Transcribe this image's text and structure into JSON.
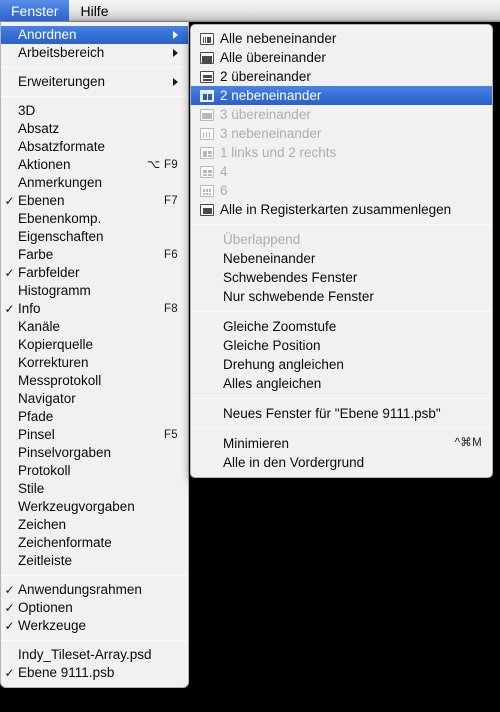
{
  "menubar": {
    "items": [
      {
        "label": "Fenster",
        "active": true
      },
      {
        "label": "Hilfe",
        "active": false
      }
    ]
  },
  "window_menu": {
    "groups": [
      {
        "items": [
          {
            "label": "Anordnen",
            "checked": false,
            "shortcut": "",
            "submenu": true,
            "selected": true,
            "disabled": false
          },
          {
            "label": "Arbeitsbereich",
            "checked": false,
            "shortcut": "",
            "submenu": true,
            "selected": false,
            "disabled": false
          }
        ]
      },
      {
        "items": [
          {
            "label": "Erweiterungen",
            "checked": false,
            "shortcut": "",
            "submenu": true,
            "selected": false,
            "disabled": false
          }
        ]
      },
      {
        "items": [
          {
            "label": "3D",
            "checked": false,
            "shortcut": ""
          },
          {
            "label": "Absatz",
            "checked": false,
            "shortcut": ""
          },
          {
            "label": "Absatzformate",
            "checked": false,
            "shortcut": ""
          },
          {
            "label": "Aktionen",
            "checked": false,
            "shortcut": "⌥ F9"
          },
          {
            "label": "Anmerkungen",
            "checked": false,
            "shortcut": ""
          },
          {
            "label": "Ebenen",
            "checked": true,
            "shortcut": "F7"
          },
          {
            "label": "Ebenenkomp.",
            "checked": false,
            "shortcut": ""
          },
          {
            "label": "Eigenschaften",
            "checked": false,
            "shortcut": ""
          },
          {
            "label": "Farbe",
            "checked": false,
            "shortcut": "F6"
          },
          {
            "label": "Farbfelder",
            "checked": true,
            "shortcut": ""
          },
          {
            "label": "Histogramm",
            "checked": false,
            "shortcut": ""
          },
          {
            "label": "Info",
            "checked": true,
            "shortcut": "F8"
          },
          {
            "label": "Kanäle",
            "checked": false,
            "shortcut": ""
          },
          {
            "label": "Kopierquelle",
            "checked": false,
            "shortcut": ""
          },
          {
            "label": "Korrekturen",
            "checked": false,
            "shortcut": ""
          },
          {
            "label": "Messprotokoll",
            "checked": false,
            "shortcut": ""
          },
          {
            "label": "Navigator",
            "checked": false,
            "shortcut": ""
          },
          {
            "label": "Pfade",
            "checked": false,
            "shortcut": ""
          },
          {
            "label": "Pinsel",
            "checked": false,
            "shortcut": "F5"
          },
          {
            "label": "Pinselvorgaben",
            "checked": false,
            "shortcut": ""
          },
          {
            "label": "Protokoll",
            "checked": false,
            "shortcut": ""
          },
          {
            "label": "Stile",
            "checked": false,
            "shortcut": ""
          },
          {
            "label": "Werkzeugvorgaben",
            "checked": false,
            "shortcut": ""
          },
          {
            "label": "Zeichen",
            "checked": false,
            "shortcut": ""
          },
          {
            "label": "Zeichenformate",
            "checked": false,
            "shortcut": ""
          },
          {
            "label": "Zeitleiste",
            "checked": false,
            "shortcut": ""
          }
        ]
      },
      {
        "items": [
          {
            "label": "Anwendungsrahmen",
            "checked": true,
            "shortcut": ""
          },
          {
            "label": "Optionen",
            "checked": true,
            "shortcut": ""
          },
          {
            "label": "Werkzeuge",
            "checked": true,
            "shortcut": ""
          }
        ]
      },
      {
        "items": [
          {
            "label": "Indy_Tileset-Array.psd",
            "checked": false,
            "shortcut": ""
          },
          {
            "label": "Ebene 9111.psb",
            "checked": true,
            "shortcut": ""
          }
        ]
      }
    ]
  },
  "arrange_submenu": {
    "groups": [
      {
        "items": [
          {
            "label": "Alle nebeneinander",
            "icon": "tile-all-vertical-icon",
            "disabled": false,
            "selected": false
          },
          {
            "label": "Alle übereinander",
            "icon": "tile-all-horizontal-icon",
            "disabled": false,
            "selected": false
          },
          {
            "label": "2 übereinander",
            "icon": "two-up-horizontal-icon",
            "disabled": false,
            "selected": false
          },
          {
            "label": "2 nebeneinander",
            "icon": "two-up-vertical-icon",
            "disabled": false,
            "selected": true
          },
          {
            "label": "3 übereinander",
            "icon": "three-up-horizontal-icon",
            "disabled": true,
            "selected": false
          },
          {
            "label": "3 nebeneinander",
            "icon": "three-up-vertical-icon",
            "disabled": true,
            "selected": false
          },
          {
            "label": "1 links und 2 rechts",
            "icon": "one-left-two-right-icon",
            "disabled": true,
            "selected": false
          },
          {
            "label": "4",
            "icon": "four-up-grid-icon",
            "disabled": true,
            "selected": false
          },
          {
            "label": "6",
            "icon": "six-up-grid-icon",
            "disabled": true,
            "selected": false
          },
          {
            "label": "Alle in Registerkarten zusammenlegen",
            "icon": "consolidate-all-tabs-icon",
            "disabled": false,
            "selected": false
          }
        ]
      },
      {
        "items": [
          {
            "label": "Überlappend",
            "icon": "",
            "disabled": true,
            "selected": false
          },
          {
            "label": "Nebeneinander",
            "icon": "",
            "disabled": false,
            "selected": false
          },
          {
            "label": "Schwebendes Fenster",
            "icon": "",
            "disabled": false,
            "selected": false
          },
          {
            "label": "Nur schwebende Fenster",
            "icon": "",
            "disabled": false,
            "selected": false
          }
        ]
      },
      {
        "items": [
          {
            "label": "Gleiche Zoomstufe",
            "icon": "",
            "disabled": false,
            "selected": false
          },
          {
            "label": "Gleiche Position",
            "icon": "",
            "disabled": false,
            "selected": false
          },
          {
            "label": "Drehung angleichen",
            "icon": "",
            "disabled": false,
            "selected": false
          },
          {
            "label": "Alles angleichen",
            "icon": "",
            "disabled": false,
            "selected": false
          }
        ]
      },
      {
        "items": [
          {
            "label": "Neues Fenster für \"Ebene 9111.psb\"",
            "icon": "",
            "disabled": false,
            "selected": false
          }
        ]
      },
      {
        "items": [
          {
            "label": "Minimieren",
            "icon": "",
            "shortcut": "^⌘M",
            "disabled": false,
            "selected": false
          },
          {
            "label": "Alle in den Vordergrund",
            "icon": "",
            "disabled": false,
            "selected": false
          }
        ]
      }
    ]
  },
  "icons": {
    "checkmark": "✓",
    "submenu_arrow": "submenu-arrow-icon"
  },
  "colors": {
    "highlight": "#3670d6",
    "menu_bg": "#f1f1f1",
    "disabled_text": "#adadad",
    "desktop": "#000000"
  }
}
